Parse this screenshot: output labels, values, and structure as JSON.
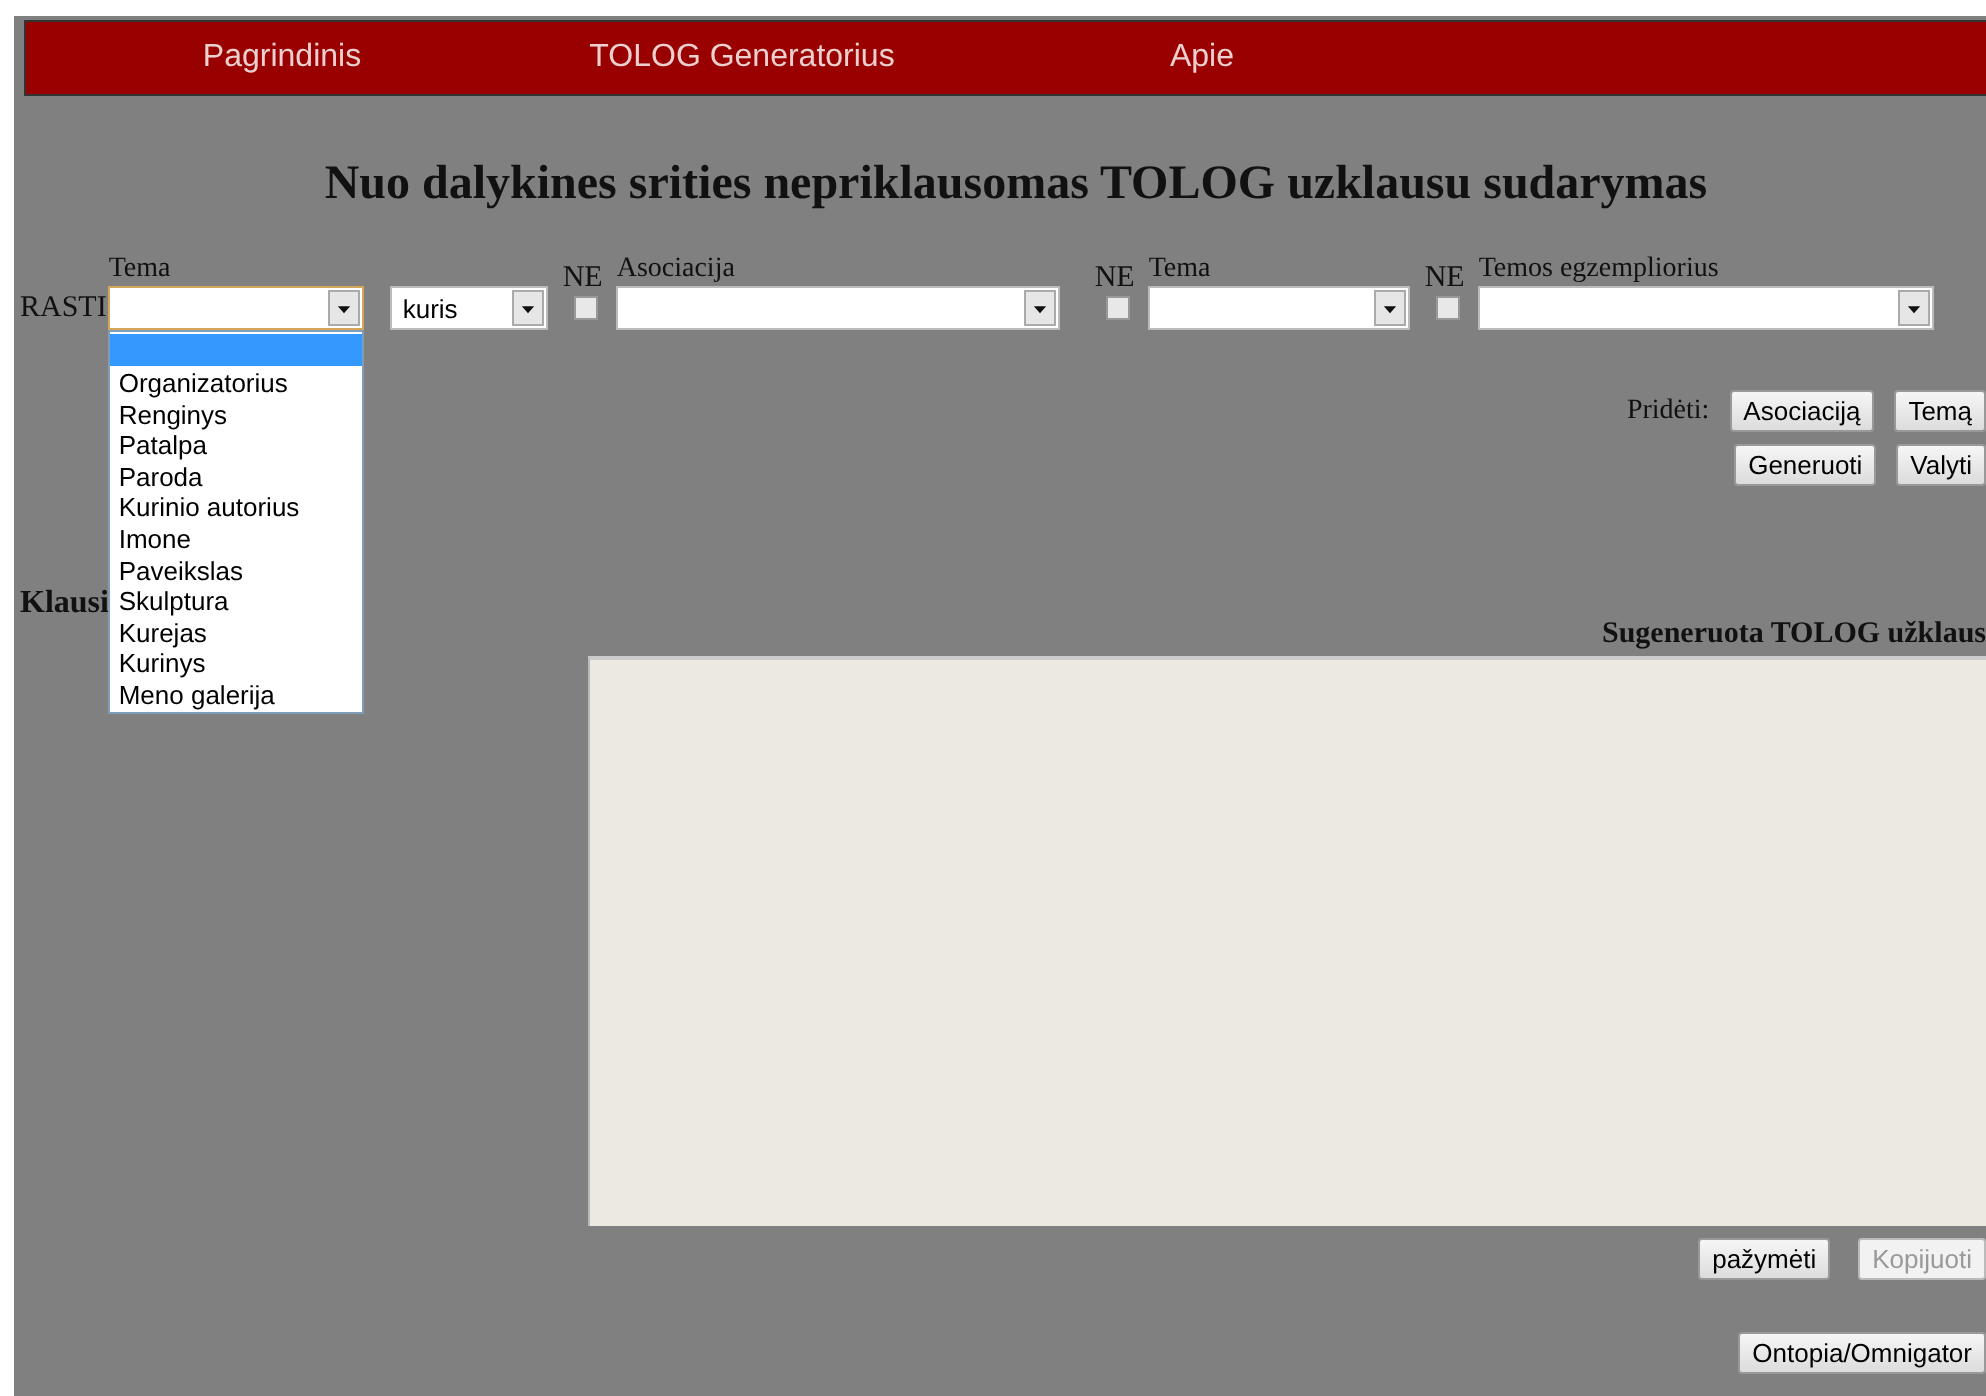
{
  "nav": [
    {
      "label": "Pagrindinis"
    },
    {
      "label": "TOLOG Generatorius"
    },
    {
      "label": "Apie"
    }
  ],
  "title": "Nuo dalykines srities nepriklausomas TOLOG uzklausu sudarymas",
  "query": {
    "prefix": "RASTI",
    "topic": {
      "label": "Tema"
    },
    "relation": {
      "value": "kuris"
    },
    "association": {
      "negation": "NE",
      "negated": false,
      "label": "Asociacija"
    },
    "topic2": {
      "negation": "NE",
      "negated": false,
      "label": "Tema"
    },
    "instance": {
      "negation": "NE",
      "negated": false,
      "label": "Temos egzempliorius"
    }
  },
  "dropdown": {
    "blank_option_highlighted": true,
    "options": [
      "Organizatorius",
      "Renginys",
      "Patalpa",
      "Paroda",
      "Kurinio autorius",
      "Imone",
      "Paveikslas",
      "Skulptura",
      "Kurejas",
      "Kurinys",
      "Meno galerija"
    ]
  },
  "add": {
    "label": "Pridėti:",
    "buttons": [
      {
        "label": "Asociaciją",
        "disabled": false
      },
      {
        "label": "Temą",
        "disabled": false
      }
    ]
  },
  "actions": [
    {
      "label": "Generuoti",
      "disabled": false
    },
    {
      "label": "Valyti",
      "disabled": false
    }
  ],
  "questions_heading": "Klausi",
  "output": {
    "heading": "Sugeneruota TOLOG užklaus",
    "buttons": [
      {
        "label": "pažymėti",
        "disabled": false
      },
      {
        "label": "Kopijuoti",
        "disabled": true
      }
    ]
  },
  "footer_button": {
    "label": "Ontopia/Omnigator",
    "disabled": false
  }
}
